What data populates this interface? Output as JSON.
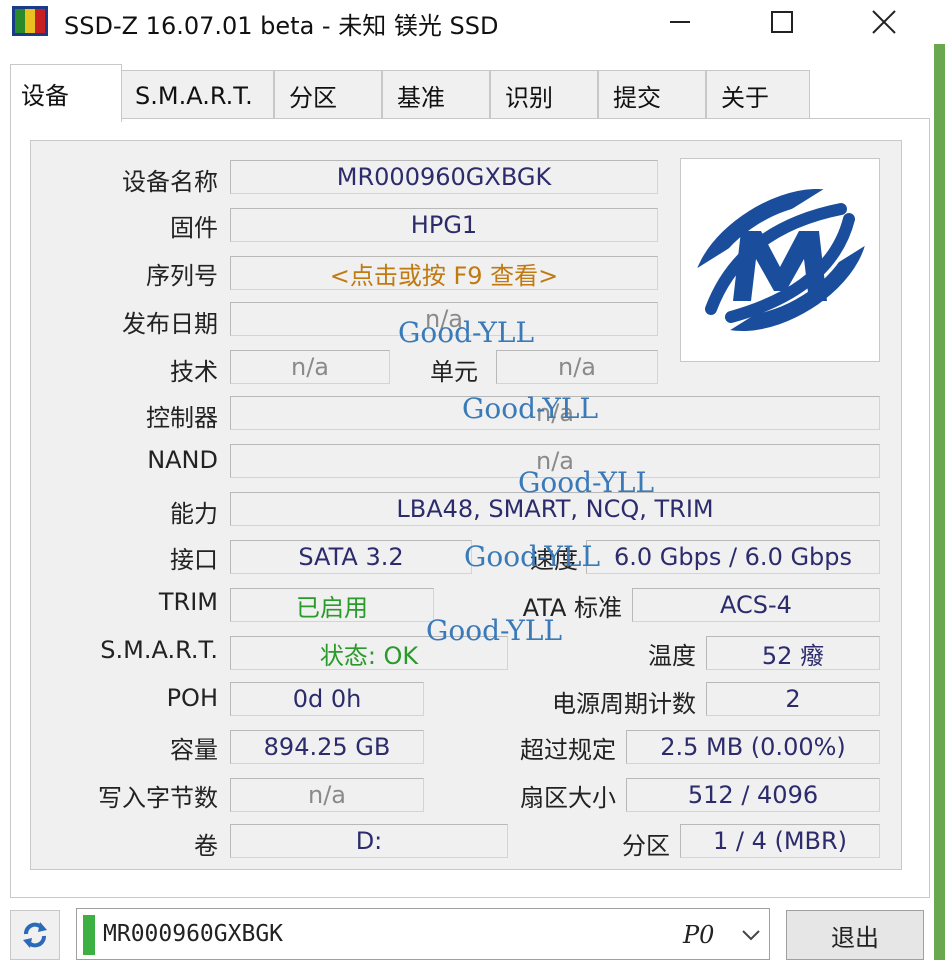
{
  "window": {
    "title": "SSD-Z 16.07.01 beta - 未知 镁光 SSD"
  },
  "tabs": [
    {
      "label": "设备",
      "active": true
    },
    {
      "label": "S.M.A.R.T."
    },
    {
      "label": "分区"
    },
    {
      "label": "基准"
    },
    {
      "label": "识别"
    },
    {
      "label": "提交"
    },
    {
      "label": "关于"
    }
  ],
  "device": {
    "name_label": "设备名称",
    "name": "MR000960GXBGK",
    "firmware_label": "固件",
    "firmware": "HPG1",
    "serial_label": "序列号",
    "serial": "<点击或按 F9 查看>",
    "release_label": "发布日期",
    "release": "n/a",
    "tech_label": "技术",
    "tech": "n/a",
    "cell_label": "单元",
    "cell": "n/a",
    "controller_label": "控制器",
    "controller": "n/a",
    "nand_label": "NAND",
    "nand": "n/a",
    "capability_label": "能力",
    "capability": "LBA48, SMART, NCQ, TRIM",
    "interface_label": "接口",
    "interface": "SATA 3.2",
    "speed_label": "速度",
    "speed": "6.0 Gbps / 6.0 Gbps",
    "trim_label": "TRIM",
    "trim": "已启用",
    "ata_label": "ATA 标准",
    "ata": "ACS-4",
    "smart_label": "S.M.A.R.T.",
    "smart": "状态: OK",
    "temp_label": "温度",
    "temp": "52 癈",
    "poh_label": "POH",
    "poh": "0d 0h",
    "power_cycle_label": "电源周期计数",
    "power_cycle": "2",
    "capacity_label": "容量",
    "capacity": "894.25 GB",
    "over_prov_label": "超过规定",
    "over_prov": "2.5 MB (0.00%)",
    "bytes_written_label": "写入字节数",
    "bytes_written": "n/a",
    "sector_label": "扇区大小",
    "sector": "512 / 4096",
    "volume_label": "卷",
    "volume": "D:",
    "partition_label": "分区",
    "partition": "1 / 4 (MBR)"
  },
  "watermark": "Good-YLL",
  "footer": {
    "drive": "MR000960GXBGK",
    "port": "P0",
    "exit_label": "退出"
  },
  "colors": {
    "logo_blue": "#1a4e9c",
    "status_green": "#2a9a2a",
    "serial_orange": "#c07a10"
  }
}
